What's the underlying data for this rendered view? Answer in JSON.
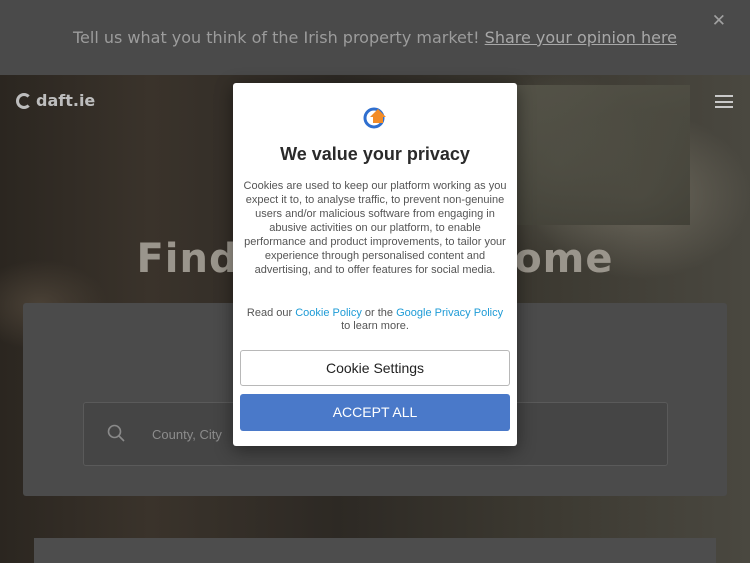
{
  "banner": {
    "text": "Tell us what you think of the Irish property market! ",
    "link": "Share your opinion here",
    "close_glyph": "✕"
  },
  "header": {
    "logo_text": "daft.ie"
  },
  "hero": {
    "title": "Find your new home"
  },
  "search": {
    "placeholder": "County, City"
  },
  "cookie_modal": {
    "title": "We value your privacy",
    "body": "Cookies are used to keep our platform working as you expect it to, to analyse traffic, to prevent non-genuine users and/or malicious software from engaging in abusive activities on our platform, to enable performance and product improvements, to tailor your experience through personalised content and advertising, and to offer features for social media.",
    "read_prefix": "Read our ",
    "cookie_policy_link": "Cookie Policy",
    "read_middle": " or the ",
    "google_policy_link": "Google Privacy Policy",
    "read_suffix": " to learn more.",
    "settings_button": "Cookie Settings",
    "accept_button": "ACCEPT ALL"
  },
  "colors": {
    "accent_blue": "#4a79c9",
    "link_blue": "#1e9bd6",
    "logo_orange": "#f28c28",
    "logo_blue": "#2f6fcf"
  }
}
